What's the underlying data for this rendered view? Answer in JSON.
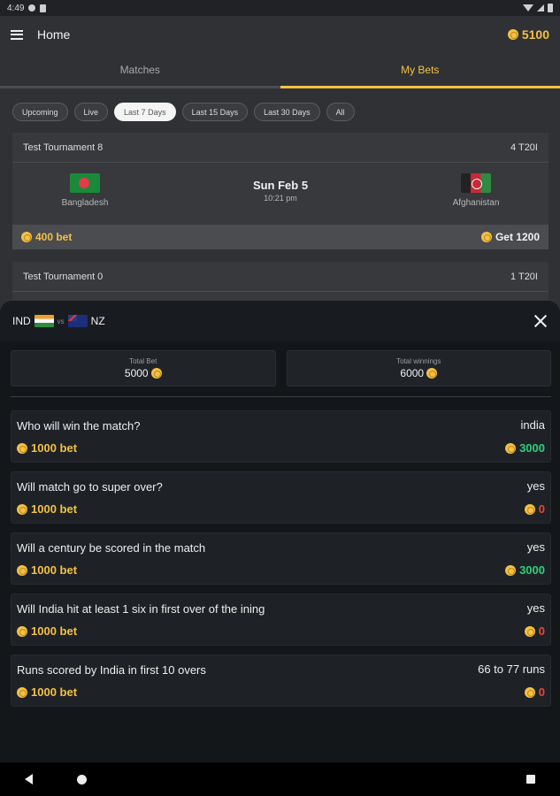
{
  "status": {
    "time": "4:49"
  },
  "app_bar": {
    "title": "Home",
    "balance": "5100"
  },
  "tabs": [
    {
      "label": "Matches",
      "active": false
    },
    {
      "label": "My Bets",
      "active": true
    }
  ],
  "filters": [
    "Upcoming",
    "Live",
    "Last 7 Days",
    "Last 15 Days",
    "Last 30 Days",
    "All"
  ],
  "active_filter": "Last 7 Days",
  "matches": [
    {
      "tournament": "Test Tournament 8",
      "format": "4 T20I",
      "team_left": "Bangladesh",
      "team_right": "Afghanistan",
      "date": "Sun Feb 5",
      "time": "10:21 pm",
      "bet": "400 bet",
      "get": "Get 1200"
    },
    {
      "tournament": "Test Tournament 0",
      "format": "1 T20I"
    }
  ],
  "sheet": {
    "team_a": "IND",
    "vs": "vs",
    "team_b": "NZ",
    "total_bet_label": "Total Bet",
    "total_bet": "5000",
    "total_winnings_label": "Total winnings",
    "total_winnings": "6000",
    "bets": [
      {
        "question": "Who will win the match?",
        "answer": "india",
        "amount": "1000 bet",
        "winnings": "3000",
        "won": true
      },
      {
        "question": "Will match go to super over?",
        "answer": "yes",
        "amount": "1000 bet",
        "winnings": "0",
        "won": false
      },
      {
        "question": "Will a century be scored in the match",
        "answer": "yes",
        "amount": "1000 bet",
        "winnings": "3000",
        "won": true
      },
      {
        "question": "Will India hit at least 1 six in first over of the ining",
        "answer": "yes",
        "amount": "1000 bet",
        "winnings": "0",
        "won": false
      },
      {
        "question": "Runs scored by India in first 10 overs",
        "answer": "66 to 77 runs",
        "amount": "1000 bet",
        "winnings": "0",
        "won": false
      }
    ]
  },
  "colors": {
    "accent": "#f5c044",
    "win": "#2ecf7a",
    "loss": "#e8473a"
  }
}
